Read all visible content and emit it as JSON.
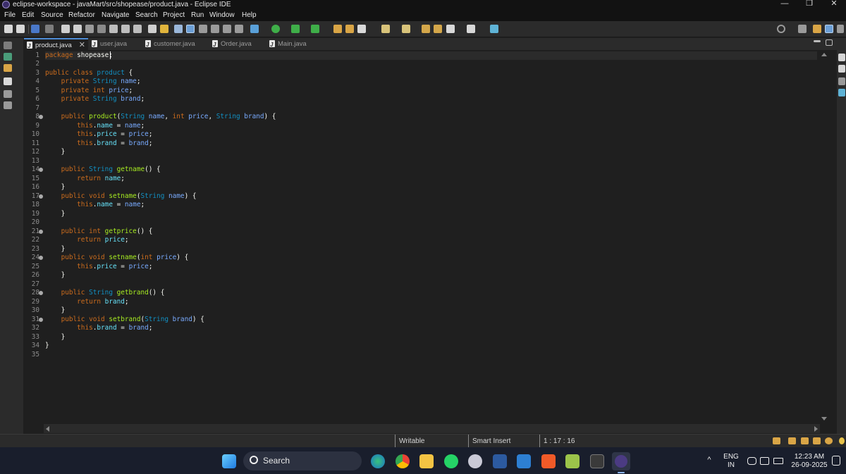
{
  "window": {
    "title": "eclipse-workspace - javaMart/src/shopease/product.java - Eclipse IDE",
    "controls": {
      "minimize": "—",
      "maximize": "❐",
      "close": "✕"
    }
  },
  "menu": [
    "File",
    "Edit",
    "Source",
    "Refactor",
    "Navigate",
    "Search",
    "Project",
    "Run",
    "Window",
    "Help"
  ],
  "tabs": [
    {
      "label": "product.java",
      "active": true,
      "close": "✕"
    },
    {
      "label": "user.java",
      "active": false
    },
    {
      "label": "customer.java",
      "active": false
    },
    {
      "label": "Order.java",
      "active": false
    },
    {
      "label": "Main.java",
      "active": false
    }
  ],
  "editor": {
    "lines": [
      {
        "n": "1",
        "tokens": [
          [
            "k",
            "package"
          ],
          [
            "p",
            " shopease;"
          ]
        ],
        "current": true
      },
      {
        "n": "2",
        "tokens": []
      },
      {
        "n": "3",
        "tokens": [
          [
            "k",
            "public class "
          ],
          [
            "t",
            "product"
          ],
          [
            "p",
            " {"
          ]
        ]
      },
      {
        "n": "4",
        "tokens": [
          [
            "p",
            "    "
          ],
          [
            "k",
            "private "
          ],
          [
            "t",
            "String "
          ],
          [
            "d",
            "name"
          ],
          [
            "p",
            ";"
          ]
        ]
      },
      {
        "n": "5",
        "tokens": [
          [
            "p",
            "    "
          ],
          [
            "k",
            "private int "
          ],
          [
            "d",
            "price"
          ],
          [
            "p",
            ";"
          ]
        ]
      },
      {
        "n": "6",
        "tokens": [
          [
            "p",
            "    "
          ],
          [
            "k",
            "private "
          ],
          [
            "t",
            "String "
          ],
          [
            "d",
            "brand"
          ],
          [
            "p",
            ";"
          ]
        ]
      },
      {
        "n": "7",
        "tokens": []
      },
      {
        "n": "8",
        "fold": true,
        "tokens": [
          [
            "p",
            "    "
          ],
          [
            "k",
            "public "
          ],
          [
            "f",
            "product"
          ],
          [
            "p",
            "("
          ],
          [
            "t",
            "String "
          ],
          [
            "d",
            "name"
          ],
          [
            "p",
            ", "
          ],
          [
            "k",
            "int "
          ],
          [
            "d",
            "price"
          ],
          [
            "p",
            ", "
          ],
          [
            "t",
            "String "
          ],
          [
            "d",
            "brand"
          ],
          [
            "p",
            ") {"
          ]
        ]
      },
      {
        "n": "9",
        "tokens": [
          [
            "p",
            "        "
          ],
          [
            "k",
            "this"
          ],
          [
            "p",
            "."
          ],
          [
            "fd",
            "name"
          ],
          [
            "p",
            " = "
          ],
          [
            "d",
            "name"
          ],
          [
            "p",
            ";"
          ]
        ]
      },
      {
        "n": "10",
        "tokens": [
          [
            "p",
            "        "
          ],
          [
            "k",
            "this"
          ],
          [
            "p",
            "."
          ],
          [
            "fd",
            "price"
          ],
          [
            "p",
            " = "
          ],
          [
            "d",
            "price"
          ],
          [
            "p",
            ";"
          ]
        ]
      },
      {
        "n": "11",
        "tokens": [
          [
            "p",
            "        "
          ],
          [
            "k",
            "this"
          ],
          [
            "p",
            "."
          ],
          [
            "fd",
            "brand"
          ],
          [
            "p",
            " = "
          ],
          [
            "d",
            "brand"
          ],
          [
            "p",
            ";"
          ]
        ]
      },
      {
        "n": "12",
        "tokens": [
          [
            "p",
            "    }"
          ]
        ]
      },
      {
        "n": "13",
        "tokens": []
      },
      {
        "n": "14",
        "fold": true,
        "tokens": [
          [
            "p",
            "    "
          ],
          [
            "k",
            "public "
          ],
          [
            "t",
            "String "
          ],
          [
            "f",
            "getname"
          ],
          [
            "p",
            "() {"
          ]
        ]
      },
      {
        "n": "15",
        "tokens": [
          [
            "p",
            "        "
          ],
          [
            "k",
            "return "
          ],
          [
            "fd",
            "name"
          ],
          [
            "p",
            ";"
          ]
        ]
      },
      {
        "n": "16",
        "tokens": [
          [
            "p",
            "    }"
          ]
        ]
      },
      {
        "n": "17",
        "fold": true,
        "tokens": [
          [
            "p",
            "    "
          ],
          [
            "k",
            "public void "
          ],
          [
            "f",
            "setname"
          ],
          [
            "p",
            "("
          ],
          [
            "t",
            "String "
          ],
          [
            "d",
            "name"
          ],
          [
            "p",
            ") {"
          ]
        ]
      },
      {
        "n": "18",
        "tokens": [
          [
            "p",
            "        "
          ],
          [
            "k",
            "this"
          ],
          [
            "p",
            "."
          ],
          [
            "fd",
            "name"
          ],
          [
            "p",
            " = "
          ],
          [
            "d",
            "name"
          ],
          [
            "p",
            ";"
          ]
        ]
      },
      {
        "n": "19",
        "tokens": [
          [
            "p",
            "    }"
          ]
        ]
      },
      {
        "n": "20",
        "tokens": []
      },
      {
        "n": "21",
        "fold": true,
        "tokens": [
          [
            "p",
            "    "
          ],
          [
            "k",
            "public int "
          ],
          [
            "f",
            "getprice"
          ],
          [
            "p",
            "() {"
          ]
        ]
      },
      {
        "n": "22",
        "tokens": [
          [
            "p",
            "        "
          ],
          [
            "k",
            "return "
          ],
          [
            "fd",
            "price"
          ],
          [
            "p",
            ";"
          ]
        ]
      },
      {
        "n": "23",
        "tokens": [
          [
            "p",
            "    }"
          ]
        ]
      },
      {
        "n": "24",
        "fold": true,
        "tokens": [
          [
            "p",
            "    "
          ],
          [
            "k",
            "public void "
          ],
          [
            "f",
            "setname"
          ],
          [
            "p",
            "("
          ],
          [
            "k",
            "int "
          ],
          [
            "d",
            "price"
          ],
          [
            "p",
            ") {"
          ]
        ]
      },
      {
        "n": "25",
        "tokens": [
          [
            "p",
            "        "
          ],
          [
            "k",
            "this"
          ],
          [
            "p",
            "."
          ],
          [
            "fd",
            "price"
          ],
          [
            "p",
            " = "
          ],
          [
            "d",
            "price"
          ],
          [
            "p",
            ";"
          ]
        ]
      },
      {
        "n": "26",
        "tokens": [
          [
            "p",
            "    }"
          ]
        ]
      },
      {
        "n": "27",
        "tokens": []
      },
      {
        "n": "28",
        "fold": true,
        "tokens": [
          [
            "p",
            "    "
          ],
          [
            "k",
            "public "
          ],
          [
            "t",
            "String "
          ],
          [
            "f",
            "getbrand"
          ],
          [
            "p",
            "() {"
          ]
        ]
      },
      {
        "n": "29",
        "tokens": [
          [
            "p",
            "        "
          ],
          [
            "k",
            "return "
          ],
          [
            "fd",
            "brand"
          ],
          [
            "p",
            ";"
          ]
        ]
      },
      {
        "n": "30",
        "tokens": [
          [
            "p",
            "    }"
          ]
        ]
      },
      {
        "n": "31",
        "fold": true,
        "tokens": [
          [
            "p",
            "    "
          ],
          [
            "k",
            "public void "
          ],
          [
            "f",
            "setbrand"
          ],
          [
            "p",
            "("
          ],
          [
            "t",
            "String "
          ],
          [
            "d",
            "brand"
          ],
          [
            "p",
            ") {"
          ]
        ]
      },
      {
        "n": "32",
        "tokens": [
          [
            "p",
            "        "
          ],
          [
            "k",
            "this"
          ],
          [
            "p",
            "."
          ],
          [
            "fd",
            "brand"
          ],
          [
            "p",
            " = "
          ],
          [
            "d",
            "brand"
          ],
          [
            "p",
            ";"
          ]
        ]
      },
      {
        "n": "33",
        "tokens": [
          [
            "p",
            "    }"
          ]
        ]
      },
      {
        "n": "34",
        "tokens": [
          [
            "p",
            "}"
          ]
        ]
      },
      {
        "n": "35",
        "tokens": []
      }
    ]
  },
  "status": {
    "mode": "Writable",
    "insert": "Smart Insert",
    "position": "1 : 17 : 16"
  },
  "taskbar": {
    "search_label": "Search",
    "language_top": "ENG",
    "language_bottom": "IN",
    "time": "12:23 AM",
    "date": "26-09-2025",
    "apps": [
      "start-icon",
      "search-icon",
      "laptop-icon",
      "edge-icon",
      "chrome-icon",
      "file-explorer-icon",
      "whatsapp-icon",
      "gmail-icon",
      "app-icon",
      "vscode-icon",
      "brave-icon",
      "notepad-icon",
      "terminal-icon",
      "eclipse-icon"
    ]
  },
  "colors": {
    "keyword": "#cc6c1d",
    "type": "#1290c3",
    "method": "#a7ec21",
    "field": "#66e1f8",
    "param": "#79abff",
    "plain": "#f9faf4"
  }
}
